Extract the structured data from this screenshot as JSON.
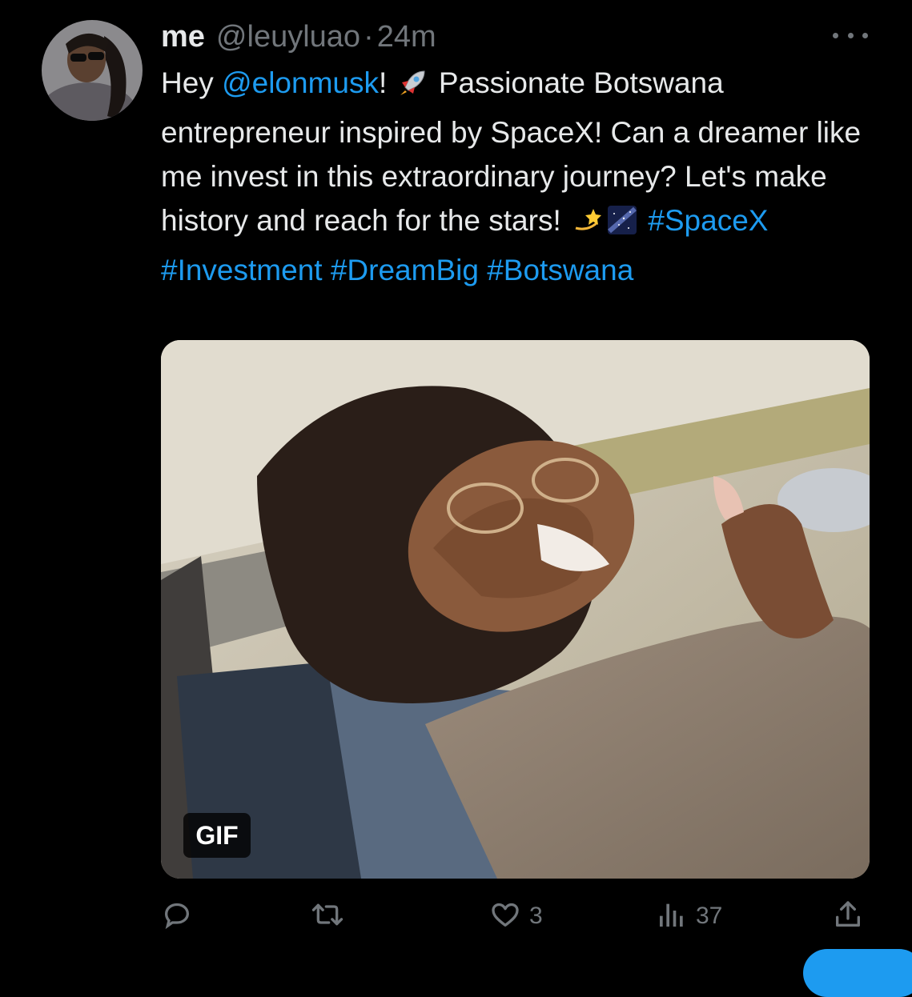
{
  "tweet": {
    "display_name": "me",
    "handle": "@leuyluao",
    "separator": "·",
    "timestamp": "24m",
    "text_segments": [
      {
        "kind": "text",
        "value": "Hey "
      },
      {
        "kind": "link",
        "value": "@elonmusk"
      },
      {
        "kind": "text",
        "value": "! "
      },
      {
        "kind": "emoji",
        "icon": "rocket-emoji"
      },
      {
        "kind": "text",
        "value": " Passionate Botswana entrepreneur inspired by SpaceX! Can a dreamer like me invest in this extraordinary journey? Let's make history and reach for the stars! "
      },
      {
        "kind": "emoji",
        "icon": "dizzy-emoji"
      },
      {
        "kind": "emoji",
        "icon": "milky-way-emoji"
      },
      {
        "kind": "text",
        "value": " "
      },
      {
        "kind": "link",
        "value": "#SpaceX"
      },
      {
        "kind": "text",
        "value": " "
      },
      {
        "kind": "link",
        "value": "#Investment"
      },
      {
        "kind": "text",
        "value": " "
      },
      {
        "kind": "link",
        "value": "#DreamBig"
      },
      {
        "kind": "text",
        "value": " "
      },
      {
        "kind": "link",
        "value": "#Botswana"
      }
    ],
    "media": {
      "badge": "GIF"
    },
    "actions": {
      "reply": {
        "icon": "reply-icon",
        "count": ""
      },
      "retweet": {
        "icon": "retweet-icon",
        "count": ""
      },
      "like": {
        "icon": "heart-icon",
        "count": "3"
      },
      "views": {
        "icon": "views-icon",
        "count": "37"
      },
      "share": {
        "icon": "share-icon",
        "count": ""
      }
    }
  },
  "colors": {
    "background": "#000000",
    "text_primary": "#e7e9ea",
    "text_secondary": "#71767b",
    "link": "#1d9bf0"
  }
}
